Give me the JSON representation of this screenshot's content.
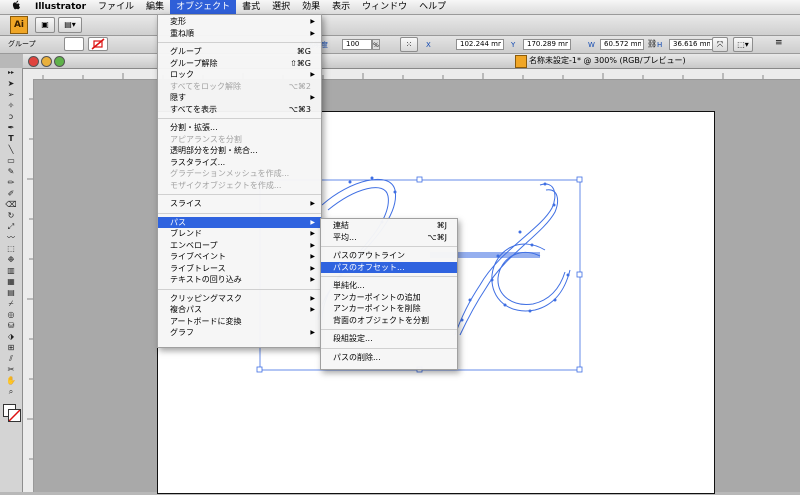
{
  "menubar": {
    "apple": "",
    "app": "Illustrator",
    "items": [
      "ファイル",
      "編集",
      "オブジェクト",
      "書式",
      "選択",
      "効果",
      "表示",
      "ウィンドウ",
      "ヘルプ"
    ],
    "active_index": 2
  },
  "appbar": {
    "logo": "Ai"
  },
  "control_bar": {
    "selection_label": "グループ",
    "opacity_label": "不透明度",
    "opacity_value": "100",
    "opacity_unit": "%",
    "x_label": "X",
    "x_value": "102.244 mm",
    "y_label": "Y",
    "y_value": "170.289 mm",
    "w_label": "W",
    "w_value": "60.572 mm",
    "h_label": "H",
    "h_value": "36.616 mm"
  },
  "document": {
    "title": "名称未設定-1* @ 300% (RGB/プレビュー)"
  },
  "object_menu": {
    "items": [
      {
        "label": "変形",
        "submenu": true
      },
      {
        "label": "重ね順",
        "submenu": true
      },
      {
        "sep": true
      },
      {
        "label": "グループ",
        "shortcut": "⌘G"
      },
      {
        "label": "グループ解除",
        "shortcut": "⇧⌘G"
      },
      {
        "label": "ロック",
        "submenu": true
      },
      {
        "label": "すべてをロック解除",
        "shortcut": "⌥⌘2",
        "disabled": true
      },
      {
        "label": "隠す",
        "submenu": true
      },
      {
        "label": "すべてを表示",
        "shortcut": "⌥⌘3"
      },
      {
        "sep": true
      },
      {
        "label": "分割・拡張..."
      },
      {
        "label": "アピアランスを分割",
        "disabled": true
      },
      {
        "label": "透明部分を分割・統合..."
      },
      {
        "label": "ラスタライズ..."
      },
      {
        "label": "グラデーションメッシュを作成...",
        "disabled": true
      },
      {
        "label": "モザイクオブジェクトを作成...",
        "disabled": true
      },
      {
        "sep": true
      },
      {
        "label": "スライス",
        "submenu": true
      },
      {
        "sep": true
      },
      {
        "label": "パス",
        "submenu": true,
        "highlighted": true
      },
      {
        "label": "ブレンド",
        "submenu": true
      },
      {
        "label": "エンベロープ",
        "submenu": true
      },
      {
        "label": "ライブペイント",
        "submenu": true
      },
      {
        "label": "ライブトレース",
        "submenu": true
      },
      {
        "label": "テキストの回り込み",
        "submenu": true
      },
      {
        "sep": true
      },
      {
        "label": "クリッピングマスク",
        "submenu": true
      },
      {
        "label": "複合パス",
        "submenu": true
      },
      {
        "label": "アートボードに変換"
      },
      {
        "label": "グラフ",
        "submenu": true
      }
    ]
  },
  "path_submenu": {
    "items": [
      {
        "label": "連結",
        "shortcut": "⌘J"
      },
      {
        "label": "平均...",
        "shortcut": "⌥⌘J"
      },
      {
        "sep": true
      },
      {
        "label": "パスのアウトライン"
      },
      {
        "label": "パスのオフセット...",
        "highlighted": true
      },
      {
        "sep": true
      },
      {
        "label": "単純化..."
      },
      {
        "label": "アンカーポイントの追加"
      },
      {
        "label": "アンカーポイントを削除"
      },
      {
        "label": "背面のオブジェクトを分割"
      },
      {
        "sep": true
      },
      {
        "label": "段組設定..."
      },
      {
        "sep": true
      },
      {
        "label": "パスの削除..."
      }
    ]
  },
  "colors": {
    "accent": "#2f63df",
    "path_stroke": "#3f6fe3",
    "ai_orange": "#f0a626"
  }
}
